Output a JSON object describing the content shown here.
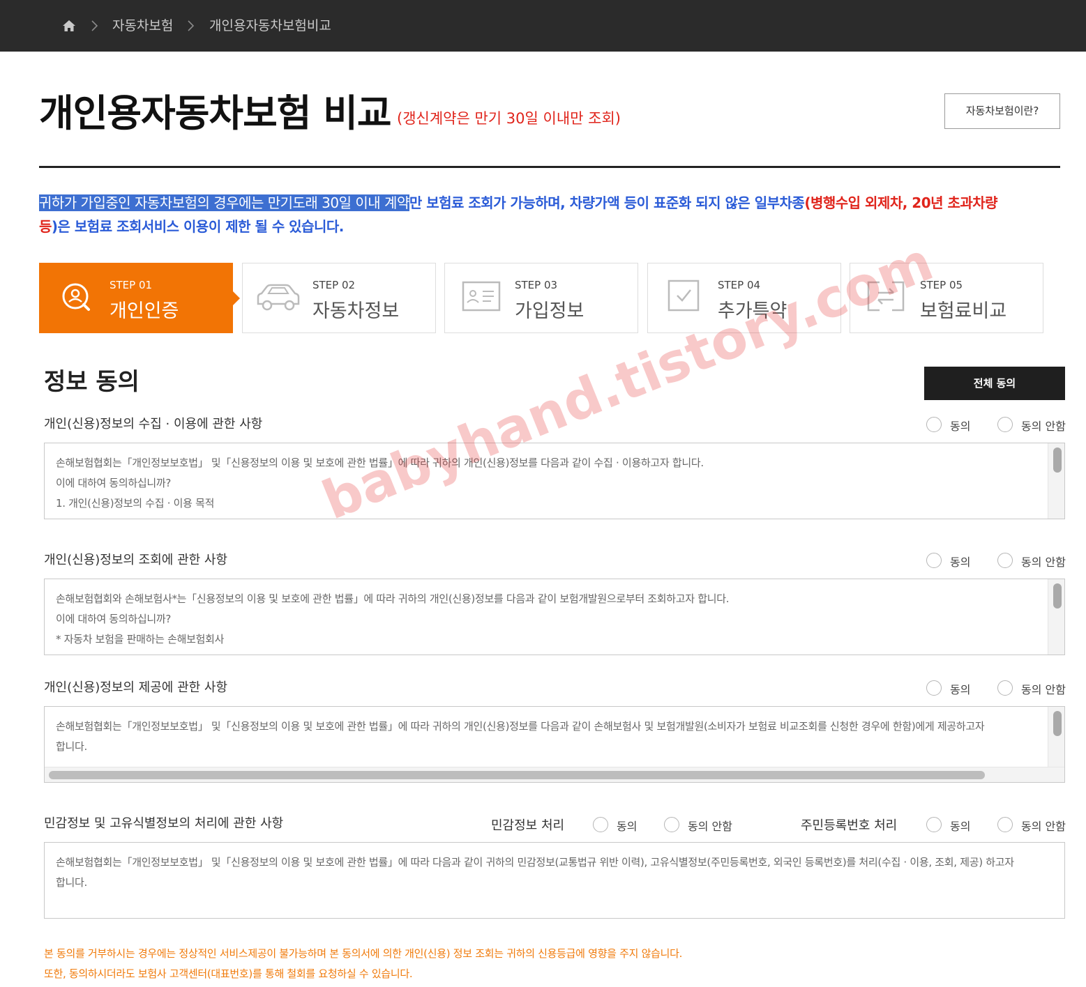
{
  "breadcrumb": {
    "home_icon": "home-icon",
    "items": [
      "자동차보험",
      "개인용자동차보험비교"
    ]
  },
  "header": {
    "title": "개인용자동차보험 비교",
    "subtitle": "(갱신계약은 만기 30일 이내만 조회)",
    "help_button": "자동차보험이란?"
  },
  "notice": {
    "highlighted": "귀하가 가입중인 자동차보험의 경우에는 만기도래 30일 이내 계약",
    "part1": "만 보험료 조회가 가능하며, 차량가액 등이 표준화 되지 않은 일부차종",
    "red1": "(병행수입 외제차, 20년 초과차량",
    "red2": "등",
    "part2": ")은 보험료 조회서비스 이용이 제한 될 수 있습니다."
  },
  "steps": [
    {
      "num": "STEP 01",
      "name": "개인인증",
      "icon": "user-search-icon",
      "active": true
    },
    {
      "num": "STEP 02",
      "name": "자동차정보",
      "icon": "car-icon",
      "active": false
    },
    {
      "num": "STEP 03",
      "name": "가입정보",
      "icon": "id-card-icon",
      "active": false
    },
    {
      "num": "STEP 04",
      "name": "추가특약",
      "icon": "checkbox-icon",
      "active": false
    },
    {
      "num": "STEP 05",
      "name": "보험료비교",
      "icon": "compare-icon",
      "active": false
    }
  ],
  "consent": {
    "title": "정보 동의",
    "all_agree": "전체 동의",
    "agree_label": "동의",
    "disagree_label": "동의 안함",
    "sections": [
      {
        "label": "개인(신용)정보의 수집 · 이용에 관한 사항",
        "lines": [
          "손해보험협회는「개인정보보호법」 및「신용정보의 이용 및 보호에 관한 법률」에 따라 귀하의 개인(신용)정보를 다음과 같이 수집 · 이용하고자 합니다.",
          "이에 대하여 동의하십니까?",
          "1. 개인(신용)정보의 수집 · 이용 목적"
        ]
      },
      {
        "label": "개인(신용)정보의 조회에 관한 사항",
        "lines": [
          "손해보험협회와 손해보험사*는「신용정보의 이용 및 보호에 관한 법률」에 따라 귀하의 개인(신용)정보를 다음과 같이 보험개발원으로부터 조회하고자 합니다.",
          "이에 대하여 동의하십니까?",
          "* 자동차 보험을 판매하는 손해보험회사"
        ]
      },
      {
        "label": "개인(신용)정보의 제공에 관한 사항",
        "lines": [
          "손해보험협회는「개인정보보호법」 및「신용정보의 이용 및 보호에 관한 법률」에 따라 귀하의 개인(신용)정보를 다음과 같이 손해보험사 및 보험개발원(소비자가 보험료 비교조회를 신청한 경우에 한함)에게 제공하고자",
          "합니다."
        ]
      },
      {
        "label": "민감정보 및 고유식별정보의 처리에 관한 사항",
        "sensitive_label": "민감정보 처리",
        "rrn_label": "주민등록번호 처리",
        "lines": [
          "손해보험협회는「개인정보보호법」 및「신용정보의 이용 및 보호에 관한 법률」에 따라 다음과 같이 귀하의 민감정보(교통법규 위반 이력), 고유식별정보(주민등록번호, 외국인 등록번호)를 처리(수집 · 이용, 조회, 제공) 하고자",
          "합니다."
        ]
      }
    ],
    "footnote": [
      "본 동의를 거부하시는 경우에는 정상적인 서비스제공이 불가능하며 본 동의서에 의한 개인(신용) 정보 조회는 귀하의 신용등급에 영향을 주지 않습니다.",
      "또한, 동의하시더라도 보험사 고객센터(대표번호)를 통해 철회를 요청하실 수 있습니다."
    ]
  },
  "watermark": "babyhand.tistory.com",
  "colors": {
    "accent": "#f27405",
    "topbar": "#2b2b2b",
    "notice_blue": "#2a5bd7",
    "notice_red": "#e0241b"
  }
}
